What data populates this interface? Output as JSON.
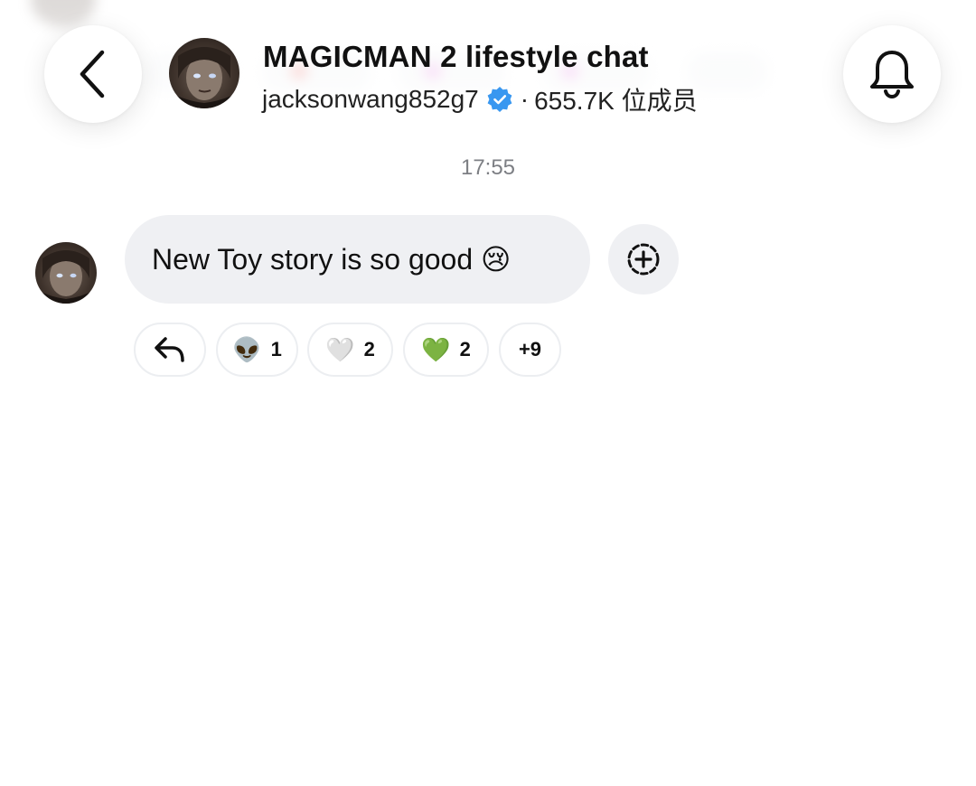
{
  "header": {
    "title": "MAGICMAN 2 lifestyle chat",
    "owner": "jacksonwang852g7",
    "separator": "·",
    "members": "655.7K 位成员",
    "back_icon": "chevron-left-icon",
    "notification_icon": "bell-icon",
    "verified_icon": "verified-badge-icon",
    "verified_color": "#3897f0"
  },
  "chat": {
    "timestamp": "17:55",
    "message": {
      "text": "New Toy story is so good 😢",
      "add_reaction_icon": "add-reaction-icon"
    },
    "reactions": [
      {
        "emoji": "👽",
        "count": "1"
      },
      {
        "emoji": "🤍",
        "count": "2"
      },
      {
        "emoji": "💚",
        "count": "2"
      }
    ],
    "more_reactions": "+9",
    "reply_icon": "reply-arrow-icon"
  },
  "colors": {
    "bubble_bg": "#eff0f3",
    "timestamp": "#7d7f84",
    "text": "#111111"
  }
}
